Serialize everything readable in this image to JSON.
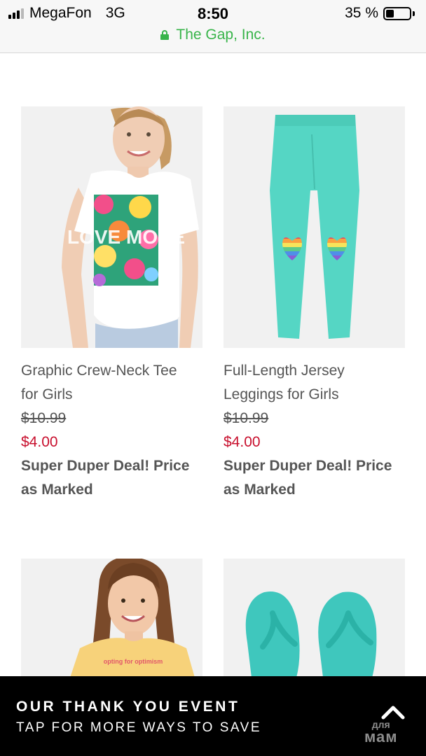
{
  "status_bar": {
    "carrier": "MegaFon",
    "network": "3G",
    "time": "8:50",
    "battery": "35 %",
    "battery_level": 0.35
  },
  "url_bar": {
    "site": "The Gap, Inc."
  },
  "products": [
    {
      "title_line1": "Graphic Crew-Neck Tee",
      "title_line2": "for Girls",
      "original_price": "$10.99",
      "sale_price": "$4.00",
      "deal_line1": "Super Duper Deal! Price",
      "deal_line2": "as Marked",
      "graphic_text": "LOVE MORE"
    },
    {
      "title_line1": "Full-Length Jersey",
      "title_line2": "Leggings for Girls",
      "original_price": "$10.99",
      "sale_price": "$4.00",
      "deal_line1": "Super Duper Deal! Price",
      "deal_line2": "as Marked"
    },
    {
      "graphic_text": "opting for optimism"
    },
    {}
  ],
  "banner": {
    "title": "OUR THANK YOU EVENT",
    "subtitle": "TAP FOR MORE WAYS TO SAVE"
  },
  "watermark": {
    "small": "для",
    "big": "мам"
  },
  "colors": {
    "sale_price": "#c8102e",
    "secure_url": "#38b44a",
    "legging_teal": "#55d6c4"
  }
}
